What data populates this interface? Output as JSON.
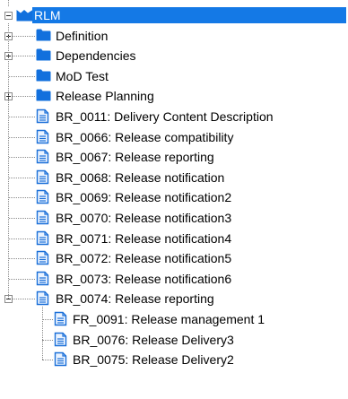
{
  "colors": {
    "selection": "#1479e6",
    "folder": "#1270dd",
    "doc_stroke": "#1a6fd8",
    "line": "#8a8a8a"
  },
  "tree": {
    "root": {
      "label": "RLM",
      "icon": "project-folder-icon",
      "expanded": true,
      "selected": true
    },
    "children": [
      {
        "label": "Definition",
        "icon": "folder-icon",
        "expander": "plus"
      },
      {
        "label": "Dependencies",
        "icon": "folder-icon",
        "expander": "plus"
      },
      {
        "label": "MoD Test",
        "icon": "folder-icon",
        "expander": "none"
      },
      {
        "label": "Release Planning",
        "icon": "folder-icon",
        "expander": "plus"
      },
      {
        "label": "BR_0011: Delivery Content Description",
        "icon": "document-icon",
        "expander": "none"
      },
      {
        "label": "BR_0066: Release compatibility",
        "icon": "document-icon",
        "expander": "none"
      },
      {
        "label": "BR_0067: Release reporting",
        "icon": "document-icon",
        "expander": "none"
      },
      {
        "label": "BR_0068: Release notification",
        "icon": "document-icon",
        "expander": "none"
      },
      {
        "label": "BR_0069: Release notification2",
        "icon": "document-icon",
        "expander": "none"
      },
      {
        "label": "BR_0070: Release notification3",
        "icon": "document-icon",
        "expander": "none"
      },
      {
        "label": "BR_0071: Release notification4",
        "icon": "document-icon",
        "expander": "none"
      },
      {
        "label": "BR_0072: Release notification5",
        "icon": "document-icon",
        "expander": "none"
      },
      {
        "label": "BR_0073: Release notification6",
        "icon": "document-icon",
        "expander": "none"
      },
      {
        "label": "BR_0074: Release reporting",
        "icon": "document-icon",
        "expander": "minus",
        "children": [
          {
            "label": "FR_0091: Release management 1",
            "icon": "document-icon"
          },
          {
            "label": "BR_0076: Release Delivery3",
            "icon": "document-icon"
          },
          {
            "label": "BR_0075: Release Delivery2",
            "icon": "document-icon"
          }
        ]
      }
    ]
  }
}
